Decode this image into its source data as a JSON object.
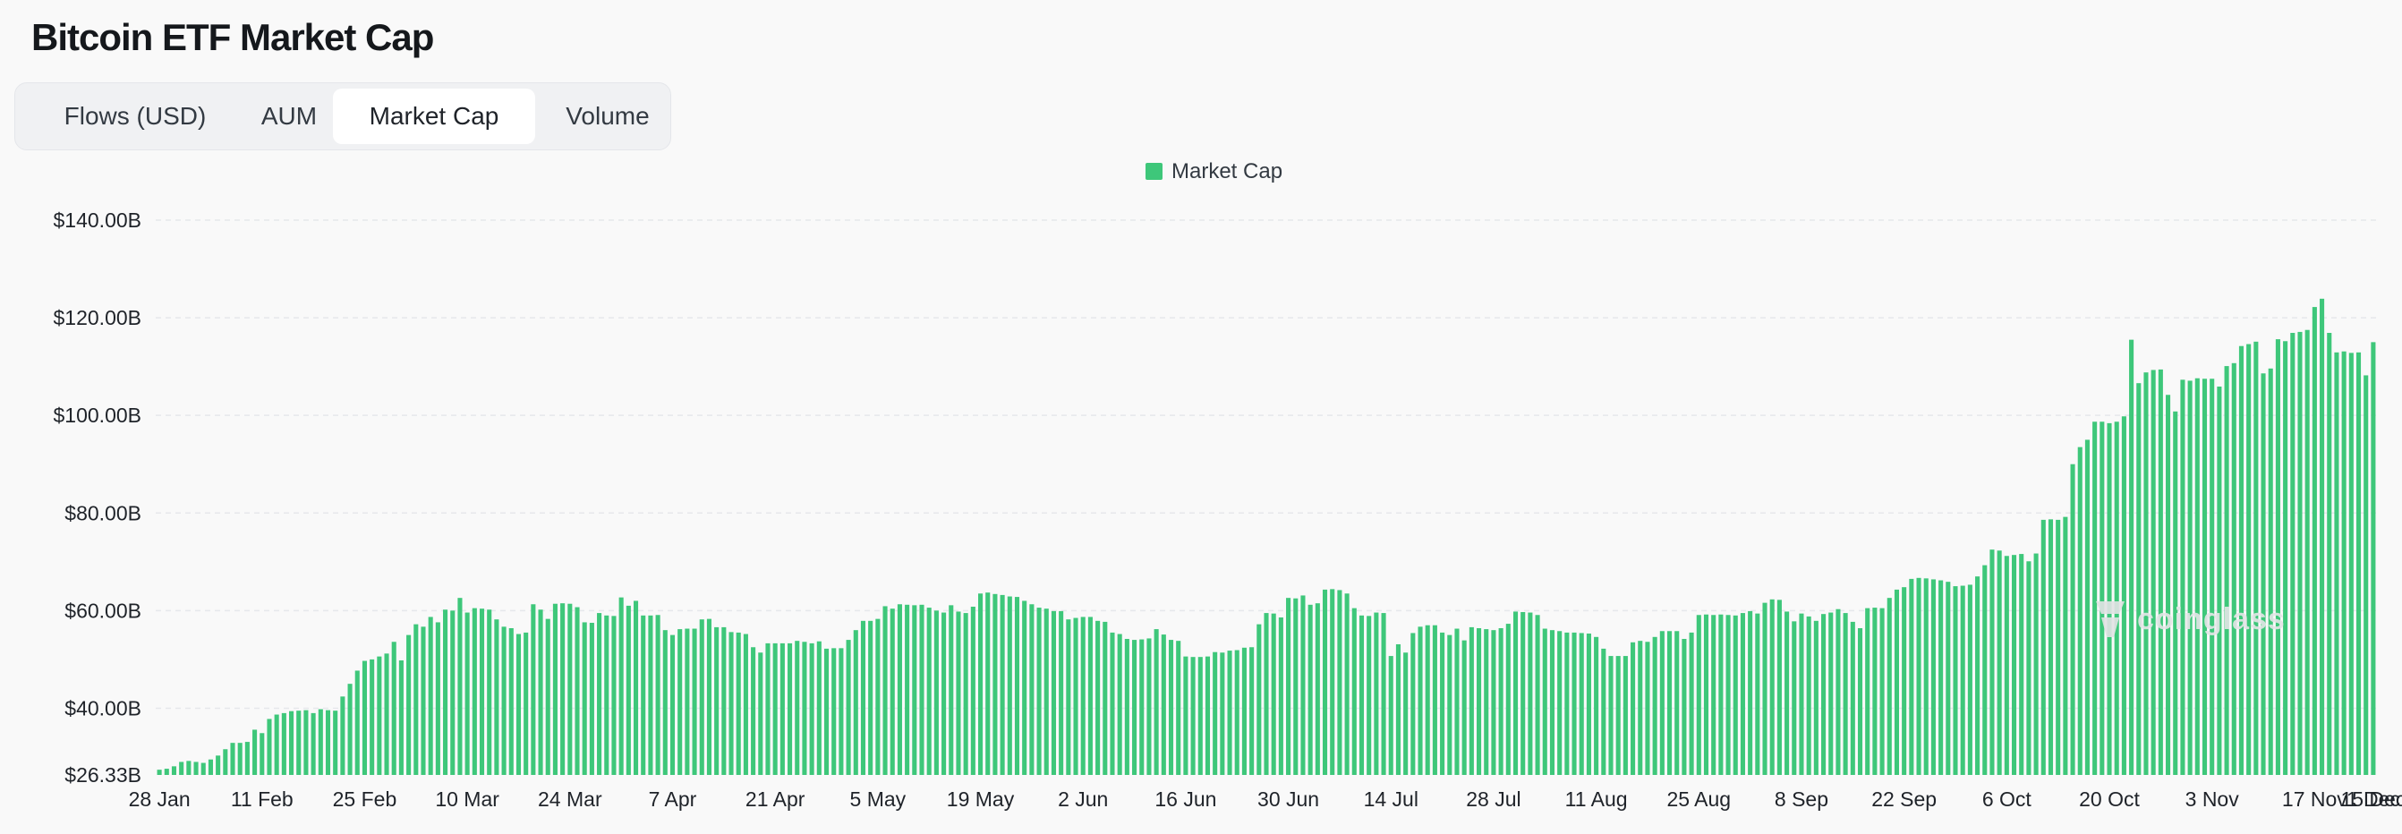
{
  "header": {
    "title": "Bitcoin ETF Market Cap"
  },
  "tabs": [
    {
      "label": "Flows (USD)",
      "active": false
    },
    {
      "label": "AUM",
      "active": false
    },
    {
      "label": "Market Cap",
      "active": true
    },
    {
      "label": "Volume",
      "active": false
    }
  ],
  "watermark": {
    "text": "coinglass"
  },
  "chart_data": {
    "type": "bar",
    "legend": {
      "label": "Market Cap",
      "color": "#3ec77a",
      "placement": "top-center"
    },
    "y_axis": {
      "ticks": [
        {
          "value": 26.33,
          "label": "$26.33B"
        },
        {
          "value": 40,
          "label": "$40.00B"
        },
        {
          "value": 60,
          "label": "$60.00B"
        },
        {
          "value": 80,
          "label": "$80.00B"
        },
        {
          "value": 100,
          "label": "$100.00B"
        },
        {
          "value": 120,
          "label": "$120.00B"
        },
        {
          "value": 140,
          "label": "$140.00B"
        }
      ],
      "min": 26.33,
      "max": 140,
      "unit": "B USD"
    },
    "x_axis": {
      "tick_labels": [
        "28 Jan",
        "11 Feb",
        "25 Feb",
        "10 Mar",
        "24 Mar",
        "7 Apr",
        "21 Apr",
        "5 May",
        "19 May",
        "2 Jun",
        "16 Jun",
        "30 Jun",
        "14 Jul",
        "28 Jul",
        "11 Aug",
        "25 Aug",
        "8 Sep",
        "22 Sep",
        "6 Oct",
        "20 Oct",
        "3 Nov",
        "17 Nov",
        "1 Dec",
        "15 Dec"
      ]
    },
    "series_color": "#3ec77a",
    "grid": "horizontal-dashed",
    "series": [
      {
        "name": "Market Cap",
        "values": [
          27.4,
          27.6,
          28.1,
          29.0,
          29.2,
          29.0,
          28.8,
          29.5,
          30.3,
          31.6,
          32.9,
          32.9,
          33.1,
          35.6,
          34.9,
          37.8,
          38.7,
          39.0,
          39.4,
          39.5,
          39.6,
          39.0,
          39.8,
          39.6,
          39.5,
          42.4,
          45.0,
          47.7,
          49.7,
          50.0,
          50.6,
          51.2,
          53.6,
          49.8,
          55.0,
          57.2,
          56.7,
          58.7,
          57.6,
          60.2,
          60.0,
          62.6,
          59.6,
          60.5,
          60.4,
          60.2,
          58.2,
          56.7,
          56.4,
          55.2,
          55.5,
          61.3,
          60.2,
          58.3,
          61.4,
          61.5,
          61.4,
          60.7,
          57.6,
          57.5,
          59.5,
          59.0,
          58.9,
          62.7,
          61.0,
          62.0,
          59.0,
          59.0,
          59.1,
          56.0,
          55.0,
          56.2,
          56.3,
          56.3,
          58.2,
          58.3,
          56.6,
          56.6,
          55.6,
          55.5,
          55.2,
          52.5,
          51.4,
          53.3,
          53.3,
          53.3,
          53.3,
          53.8,
          53.6,
          53.3,
          53.7,
          52.2,
          52.3,
          52.3,
          54.0,
          56.0,
          57.9,
          57.9,
          58.3,
          60.9,
          60.4,
          61.3,
          61.2,
          61.1,
          61.2,
          60.6,
          60.0,
          59.6,
          61.1,
          59.8,
          59.5,
          60.8,
          63.5,
          63.7,
          63.4,
          63.2,
          62.9,
          62.8,
          62.0,
          61.3,
          60.6,
          60.4,
          59.9,
          59.9,
          58.2,
          58.5,
          58.7,
          58.7,
          57.9,
          57.7,
          55.5,
          55.2,
          54.2,
          54.0,
          54.1,
          54.3,
          56.2,
          55.1,
          54.0,
          53.8,
          50.6,
          50.5,
          50.5,
          50.6,
          51.5,
          51.4,
          51.8,
          51.9,
          52.4,
          52.5,
          57.2,
          59.5,
          59.4,
          58.6,
          62.6,
          62.5,
          63.1,
          61.2,
          61.5,
          64.3,
          64.4,
          64.2,
          63.5,
          60.5,
          59.0,
          58.9,
          59.6,
          59.5,
          50.7,
          53.1,
          51.4,
          55.4,
          56.7,
          57.0,
          57.0,
          55.5,
          55.0,
          56.3,
          53.9,
          56.6,
          56.4,
          56.2,
          56.0,
          56.4,
          57.3,
          59.8,
          59.7,
          59.6,
          59.1,
          56.3,
          56.0,
          55.8,
          55.5,
          55.5,
          55.4,
          55.3,
          54.6,
          52.2,
          50.7,
          50.7,
          50.7,
          53.5,
          53.8,
          53.6,
          54.6,
          55.8,
          55.8,
          55.8,
          54.2,
          55.5,
          59.1,
          59.2,
          59.1,
          59.2,
          59.1,
          59.0,
          59.5,
          59.9,
          59.4,
          61.6,
          62.3,
          62.2,
          59.8,
          57.8,
          59.4,
          58.8,
          57.9,
          59.3,
          59.6,
          60.3,
          59.5,
          57.7,
          56.4,
          60.5,
          60.6,
          60.5,
          62.6,
          64.3,
          64.8,
          66.5,
          66.7,
          66.6,
          66.4,
          66.2,
          65.9,
          65.0,
          65.1,
          65.3,
          67.0,
          69.3,
          72.5,
          72.3,
          71.2,
          71.4,
          71.6,
          70.1,
          71.7,
          78.6,
          78.7,
          78.6,
          79.2,
          90.0,
          93.5,
          95.0,
          98.7,
          98.7,
          98.4,
          98.7,
          99.8,
          115.5,
          106.6,
          108.8,
          109.3,
          109.4,
          104.2,
          100.8,
          107.3,
          107.1,
          107.6,
          107.5,
          107.5,
          105.9,
          110.1,
          110.7,
          114.2,
          114.6,
          115.1,
          108.6,
          109.6,
          115.6,
          115.2,
          116.9,
          117.1,
          117.5,
          122.2,
          123.9,
          116.9,
          112.9,
          113.1,
          112.8,
          112.9,
          108.2,
          115.0
        ]
      }
    ]
  }
}
